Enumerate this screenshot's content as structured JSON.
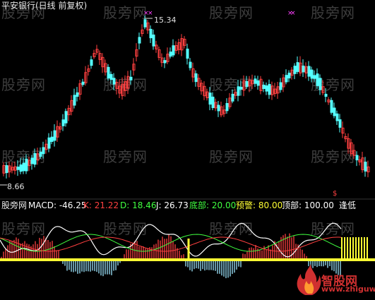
{
  "header": {
    "title": "平安银行(日线 前复权)"
  },
  "price_labels": {
    "high": "15.34",
    "low": "8.66"
  },
  "indicator": {
    "name": "股旁网",
    "macd": "MACD: -46.25",
    "k": "K: 21.22",
    "d": "D: 18.46",
    "j": "J: 26.73",
    "bottom": "底部: 20.00",
    "warning": "预警: 80.00",
    "top": "顶部: 100.00",
    "signal": "逢低"
  },
  "watermark": {
    "text": "股旁网"
  },
  "logo": {
    "name": "智股网",
    "url": "www.zhiguw.com"
  },
  "colors": {
    "background": "#000000",
    "up": "#ff4040",
    "down": "#54ffff",
    "macd_label": "#ffffff",
    "k_color": "#ff4040",
    "d_color": "#40ff40",
    "j_color": "#ffffff",
    "bottom_color": "#40ff40",
    "warning_color": "#ffff00",
    "top_color": "#ffffff",
    "signal_color": "#ffffff",
    "yellow_line": "#ffff33",
    "marker": "#ff40ff"
  }
}
